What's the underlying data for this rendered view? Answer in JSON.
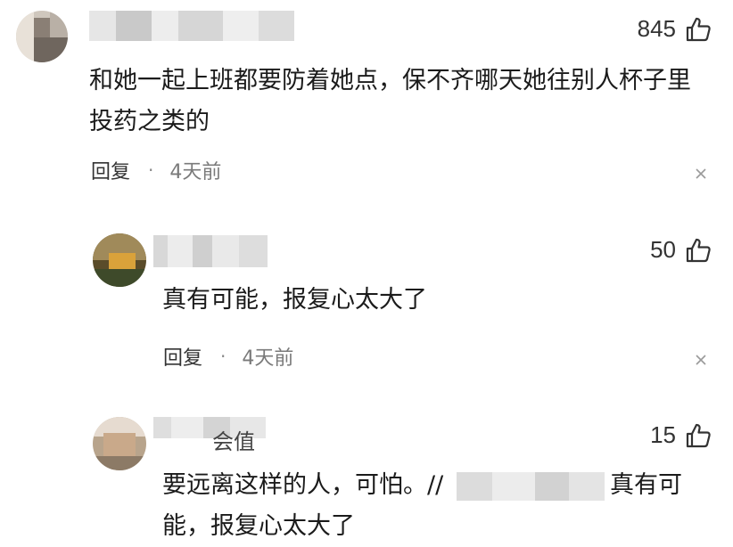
{
  "comments": [
    {
      "likes": "845",
      "text_lines": [
        "和她一起上班都要防着她点，保不齐哪天她往别人杯子里",
        "投药之类的"
      ],
      "reply_label": "回复",
      "separator": "·",
      "time": "4天前"
    },
    {
      "likes": "50",
      "text_lines": [
        "真有可能，报复心太大了"
      ],
      "reply_label": "回复",
      "separator": "·",
      "time": "4天前"
    },
    {
      "likes": "15",
      "username_fragment": "会值",
      "text_lines": [
        "要远离这样的人，可怕。//",
        "真有可",
        "能，报复心太大了"
      ]
    }
  ],
  "colors": {
    "text": "#1b1b1b",
    "meta": "#7a7a7a",
    "icon": "#333333"
  },
  "icons": [
    "thumbs-up-icon",
    "close-icon"
  ]
}
